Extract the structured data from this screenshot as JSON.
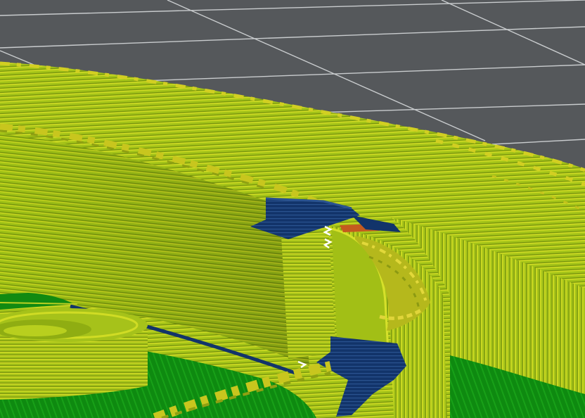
{
  "viewport": {
    "name": "3d-gcode-preview",
    "bed_color": "#55585b",
    "grid_color": "#c9ccce"
  },
  "feature_colors": {
    "perimeter": "#9cbc10",
    "perimeter_highlight": "#d6e02a",
    "seam_bump": "#d2cf22",
    "overhang_perimeter": "#12346a",
    "solid_infill": "#118a11",
    "top_infill": "#c45a1f",
    "retraction_mark": "#ffffff"
  }
}
